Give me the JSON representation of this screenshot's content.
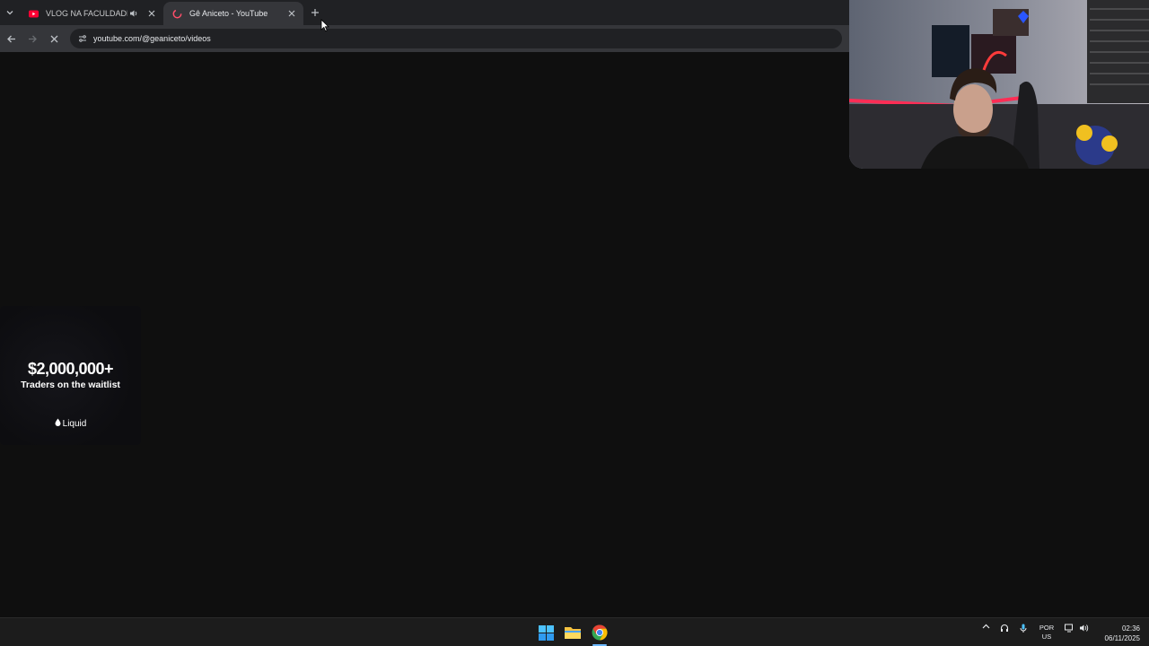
{
  "browser": {
    "tabs": [
      {
        "title": "VLOG NA FACULDADE EM M",
        "active": false,
        "audio": true
      },
      {
        "title": "Gê Aniceto - YouTube",
        "active": true,
        "audio": false
      }
    ],
    "url": "youtube.com/@geaniceto/videos"
  },
  "ad": {
    "amount": "$2,000,000+",
    "subtitle": "Traders on the waitlist",
    "brand": "Liquid"
  },
  "taskbar": {
    "apps": [
      "windows-start",
      "file-explorer",
      "chrome"
    ],
    "language": "POR",
    "keyboard": "US",
    "time": "02:36",
    "date": "06/11/2025"
  },
  "colors": {
    "page_bg": "#0f0f0f",
    "tabstrip_bg": "#202124",
    "toolbar_bg": "#35363a",
    "taskbar_bg": "#1c1c1c",
    "youtube_red": "#ff0033"
  }
}
